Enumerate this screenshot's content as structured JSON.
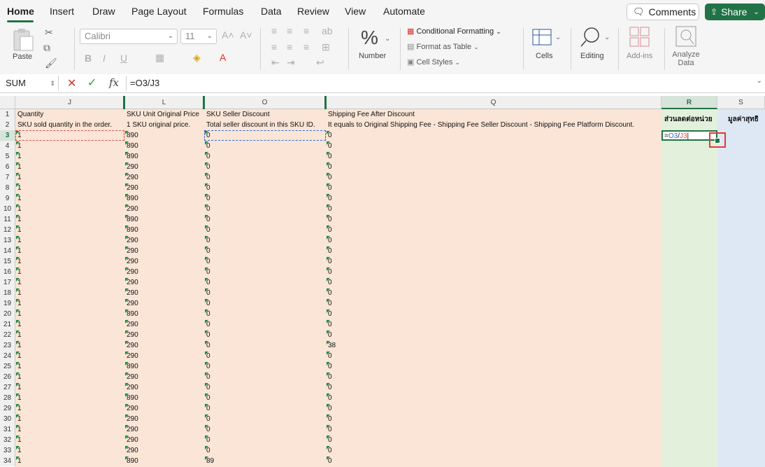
{
  "tabs": [
    "Home",
    "Insert",
    "Draw",
    "Page Layout",
    "Formulas",
    "Data",
    "Review",
    "View",
    "Automate"
  ],
  "actions": {
    "comments": "Comments",
    "share": "Share"
  },
  "ribbon": {
    "paste": "Paste",
    "font_name": "Calibri",
    "font_size": "11",
    "number": "Number",
    "conditional_formatting": "Conditional Formatting",
    "format_as_table": "Format as Table",
    "cell_styles": "Cell Styles",
    "cells": "Cells",
    "editing": "Editing",
    "addins": "Add-ins",
    "analyze_data": "Analyze Data"
  },
  "formula_bar": {
    "name_box": "SUM",
    "formula": "=O3/J3"
  },
  "columns": [
    "J",
    "L",
    "O",
    "Q",
    "R",
    "S"
  ],
  "headers": {
    "J": {
      "h1": "Quantity",
      "h2": "SKU sold quantity in the order."
    },
    "L": {
      "h1": "SKU Unit Original Price",
      "h2": "1 SKU original price."
    },
    "O": {
      "h1": "SKU Seller Discount",
      "h2": "Total seller discount in this SKU ID."
    },
    "Q": {
      "h1": "Shipping Fee After Discount",
      "h2": "It equals to Original Shipping Fee - Shipping Fee Seller Discount - Shipping Fee Platform Discount."
    },
    "R": {
      "h1": "ส่วนลดต่อหน่วย"
    },
    "S": {
      "h1": "มูลค่าสุทธิ"
    }
  },
  "active_cell": {
    "ref": "R3",
    "formula": "=O3/J3"
  },
  "rows": [
    {
      "n": 3,
      "J": "1",
      "L": "890",
      "O": "0",
      "Q": "0"
    },
    {
      "n": 4,
      "J": "1",
      "L": "890",
      "O": "0",
      "Q": "0"
    },
    {
      "n": 5,
      "J": "1",
      "L": "890",
      "O": "0",
      "Q": "0"
    },
    {
      "n": 6,
      "J": "1",
      "L": "290",
      "O": "0",
      "Q": "0"
    },
    {
      "n": 7,
      "J": "1",
      "L": "290",
      "O": "0",
      "Q": "0"
    },
    {
      "n": 8,
      "J": "1",
      "L": "290",
      "O": "0",
      "Q": "0"
    },
    {
      "n": 9,
      "J": "1",
      "L": "890",
      "O": "0",
      "Q": "0"
    },
    {
      "n": 10,
      "J": "1",
      "L": "290",
      "O": "0",
      "Q": "0"
    },
    {
      "n": 11,
      "J": "1",
      "L": "890",
      "O": "0",
      "Q": "0"
    },
    {
      "n": 12,
      "J": "1",
      "L": "890",
      "O": "0",
      "Q": "0"
    },
    {
      "n": 13,
      "J": "1",
      "L": "290",
      "O": "0",
      "Q": "0"
    },
    {
      "n": 14,
      "J": "1",
      "L": "290",
      "O": "0",
      "Q": "0"
    },
    {
      "n": 15,
      "J": "1",
      "L": "290",
      "O": "0",
      "Q": "0"
    },
    {
      "n": 16,
      "J": "1",
      "L": "290",
      "O": "0",
      "Q": "0"
    },
    {
      "n": 17,
      "J": "1",
      "L": "290",
      "O": "0",
      "Q": "0"
    },
    {
      "n": 18,
      "J": "1",
      "L": "290",
      "O": "0",
      "Q": "0"
    },
    {
      "n": 19,
      "J": "1",
      "L": "290",
      "O": "0",
      "Q": "0"
    },
    {
      "n": 20,
      "J": "1",
      "L": "890",
      "O": "0",
      "Q": "0"
    },
    {
      "n": 21,
      "J": "1",
      "L": "290",
      "O": "0",
      "Q": "0"
    },
    {
      "n": 22,
      "J": "1",
      "L": "290",
      "O": "0",
      "Q": "0"
    },
    {
      "n": 23,
      "J": "1",
      "L": "290",
      "O": "0",
      "Q": "38"
    },
    {
      "n": 24,
      "J": "1",
      "L": "290",
      "O": "0",
      "Q": "0"
    },
    {
      "n": 25,
      "J": "1",
      "L": "890",
      "O": "0",
      "Q": "0"
    },
    {
      "n": 26,
      "J": "1",
      "L": "290",
      "O": "0",
      "Q": "0"
    },
    {
      "n": 27,
      "J": "1",
      "L": "290",
      "O": "0",
      "Q": "0"
    },
    {
      "n": 28,
      "J": "1",
      "L": "890",
      "O": "0",
      "Q": "0"
    },
    {
      "n": 29,
      "J": "1",
      "L": "290",
      "O": "0",
      "Q": "0"
    },
    {
      "n": 30,
      "J": "1",
      "L": "290",
      "O": "0",
      "Q": "0"
    },
    {
      "n": 31,
      "J": "1",
      "L": "290",
      "O": "0",
      "Q": "0"
    },
    {
      "n": 32,
      "J": "1",
      "L": "290",
      "O": "0",
      "Q": "0"
    },
    {
      "n": 33,
      "J": "1",
      "L": "290",
      "O": "0",
      "Q": "0"
    },
    {
      "n": 34,
      "J": "1",
      "L": "890",
      "O": "89",
      "Q": "0"
    }
  ]
}
